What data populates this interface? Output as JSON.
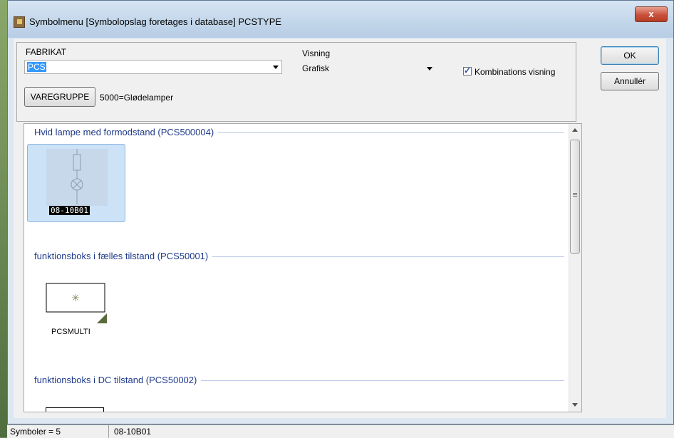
{
  "window": {
    "title": "Symbolmenu [Symbolopslag foretages i database]  PCSTYPE",
    "close_label": "x"
  },
  "fabrikat": {
    "label": "FABRIKAT",
    "value": "PCS"
  },
  "visning": {
    "label": "Visning",
    "value": "Grafisk"
  },
  "kombination": {
    "label": "Kombinations visning",
    "checked": true
  },
  "varegruppe": {
    "button_label": "VAREGRUPPE",
    "value": "5000=Glødelamper"
  },
  "buttons": {
    "ok": "OK",
    "cancel": "Annullér"
  },
  "sections": [
    {
      "title": "Hvid lampe med formodstand (PCS500004)",
      "items": [
        {
          "caption": "08-10B01",
          "selected": true
        }
      ]
    },
    {
      "title": "funktionsboks i fælles tilstand (PCS50001)",
      "items": [
        {
          "caption": "PCSMULTI",
          "selected": false
        }
      ]
    },
    {
      "title": "funktionsboks i DC tilstand (PCS50002)",
      "items": []
    }
  ],
  "status": {
    "count": "Symboler = 5",
    "selected": "08-10B01"
  }
}
